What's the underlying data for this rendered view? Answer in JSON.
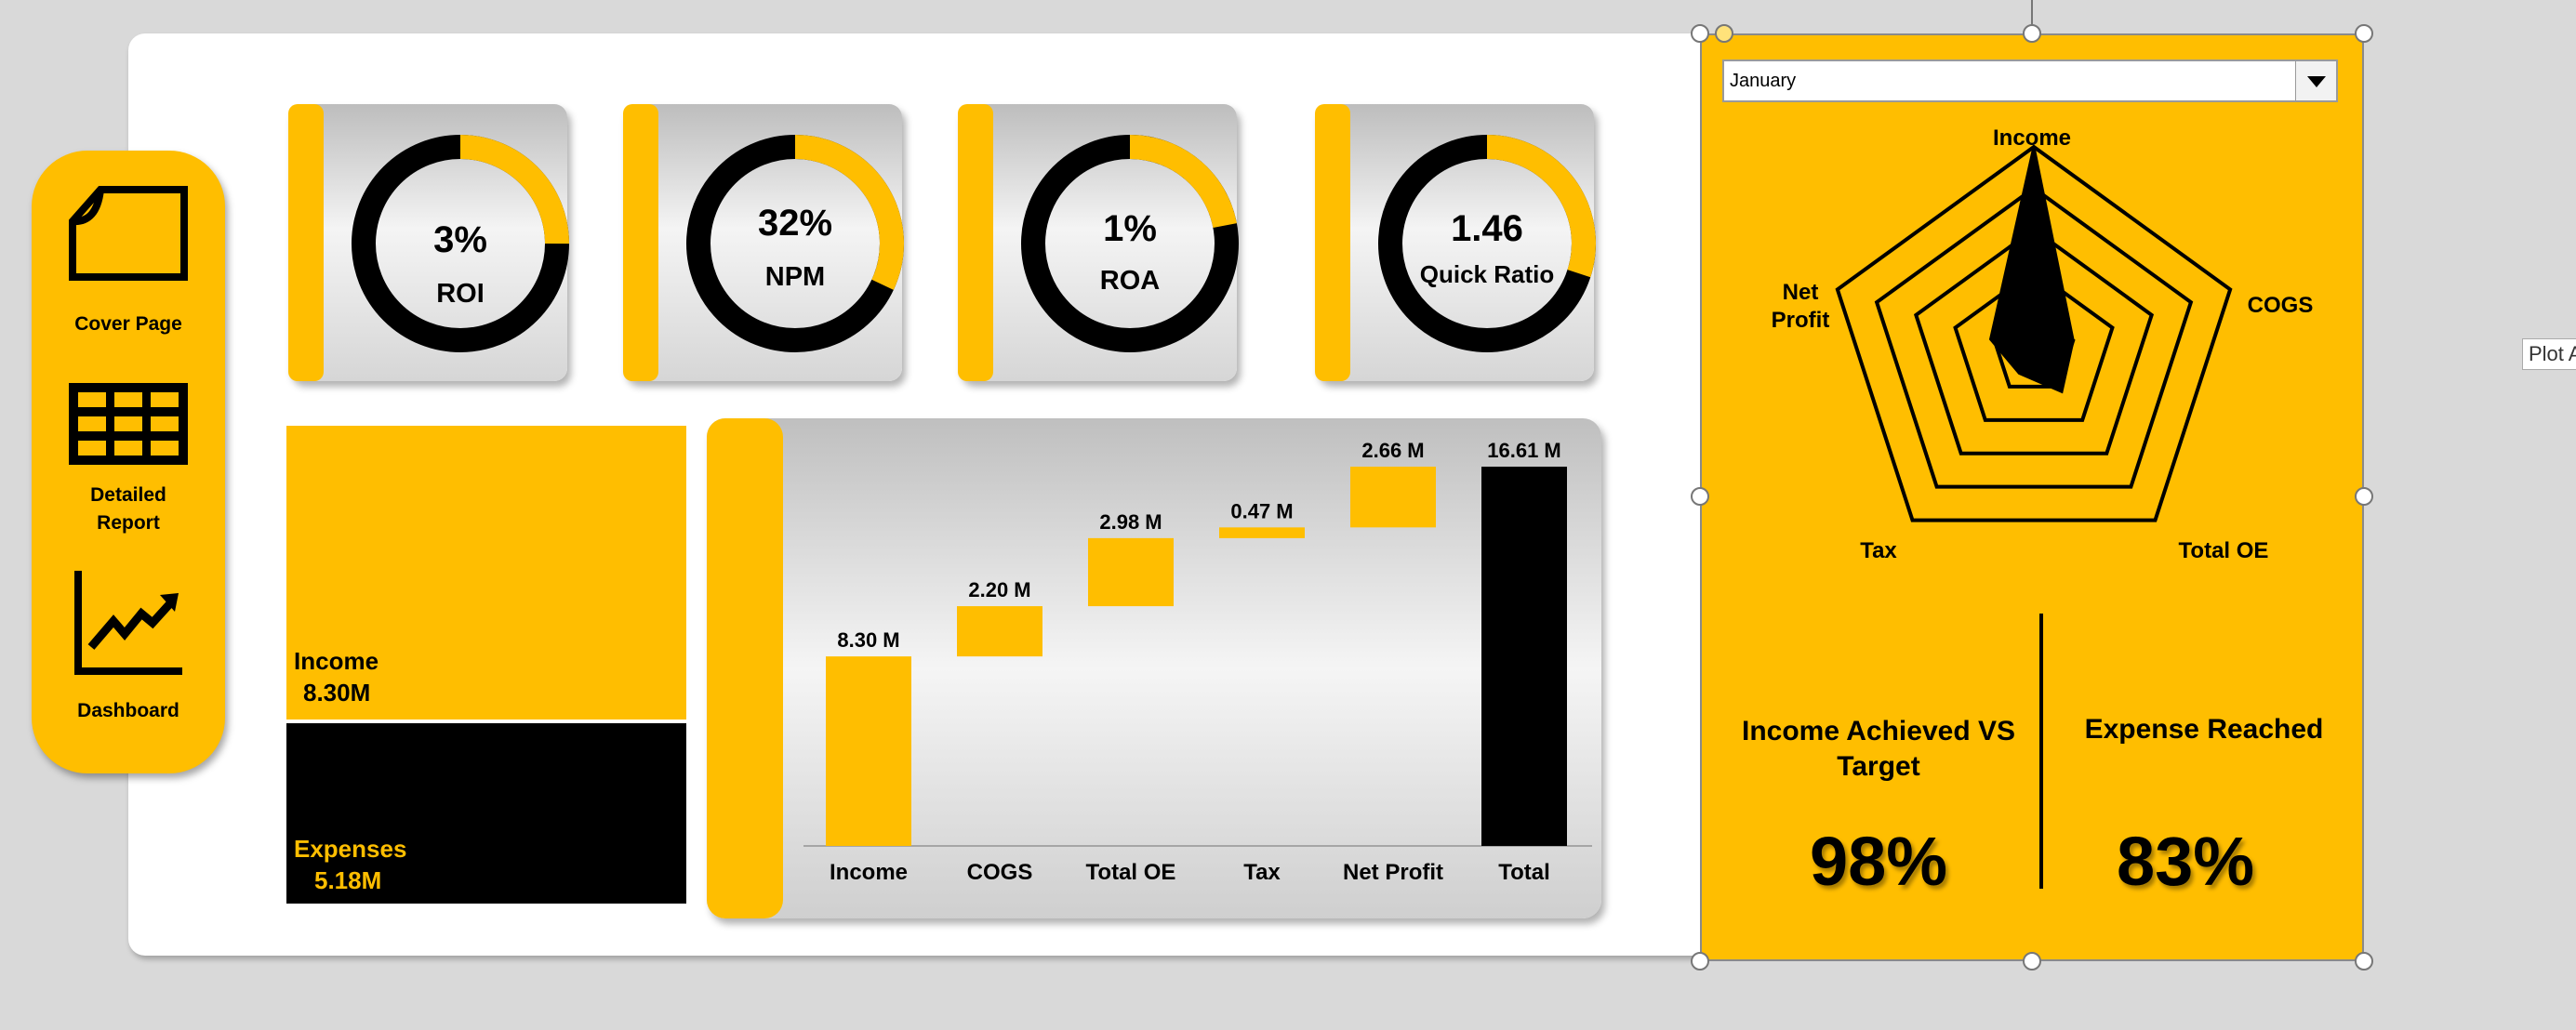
{
  "nav": {
    "items": [
      {
        "label": "Cover Page",
        "icon": "page-icon"
      },
      {
        "label": "Detailed Report",
        "icon": "table-icon"
      },
      {
        "label": "Dashboard",
        "icon": "chart-icon"
      }
    ]
  },
  "kpis": [
    {
      "value": "3%",
      "label": "ROI",
      "fraction": 0.25
    },
    {
      "value": "32%",
      "label": "NPM",
      "fraction": 0.32
    },
    {
      "value": "1%",
      "label": "ROA",
      "fraction": 0.22
    },
    {
      "value": "1.46",
      "label": "Quick Ratio",
      "fraction": 0.3
    }
  ],
  "summary": {
    "income_label": "Income",
    "income_value": "8.30M",
    "expense_label": "Expenses",
    "expense_value": "5.18M"
  },
  "month_select": {
    "value": "January"
  },
  "radar": {
    "labels": {
      "income": "Income",
      "cogs": "COGS",
      "total_oe": "Total OE",
      "tax": "Tax",
      "net_profit": "Net Profit"
    }
  },
  "achievement": {
    "income_title": "Income Achieved VS Target",
    "income_value": "98%",
    "expense_title": "Expense Reached",
    "expense_value": "83%"
  },
  "tooltip": {
    "text": "Plot A"
  },
  "colors": {
    "accent": "#ffbe00",
    "dark": "#000000"
  },
  "chart_data": [
    {
      "type": "bar",
      "subtype": "waterfall",
      "categories": [
        "Income",
        "COGS",
        "Total OE",
        "Tax",
        "Net Profit",
        "Total"
      ],
      "values": [
        8.3,
        2.2,
        2.98,
        0.47,
        2.66,
        16.61
      ],
      "bases": [
        0,
        8.3,
        10.5,
        13.48,
        13.95,
        0
      ],
      "data_labels": [
        "8.30 M",
        "2.20 M",
        "2.98 M",
        "0.47 M",
        "2.66 M",
        "16.61 M"
      ],
      "ylim": [
        0,
        16.61
      ]
    },
    {
      "type": "radar",
      "axes": [
        "Income",
        "COGS",
        "Total OE",
        "Tax",
        "Net Profit"
      ],
      "values": [
        1.0,
        0.2,
        0.23,
        0.12,
        0.22
      ],
      "rings": 5
    }
  ]
}
